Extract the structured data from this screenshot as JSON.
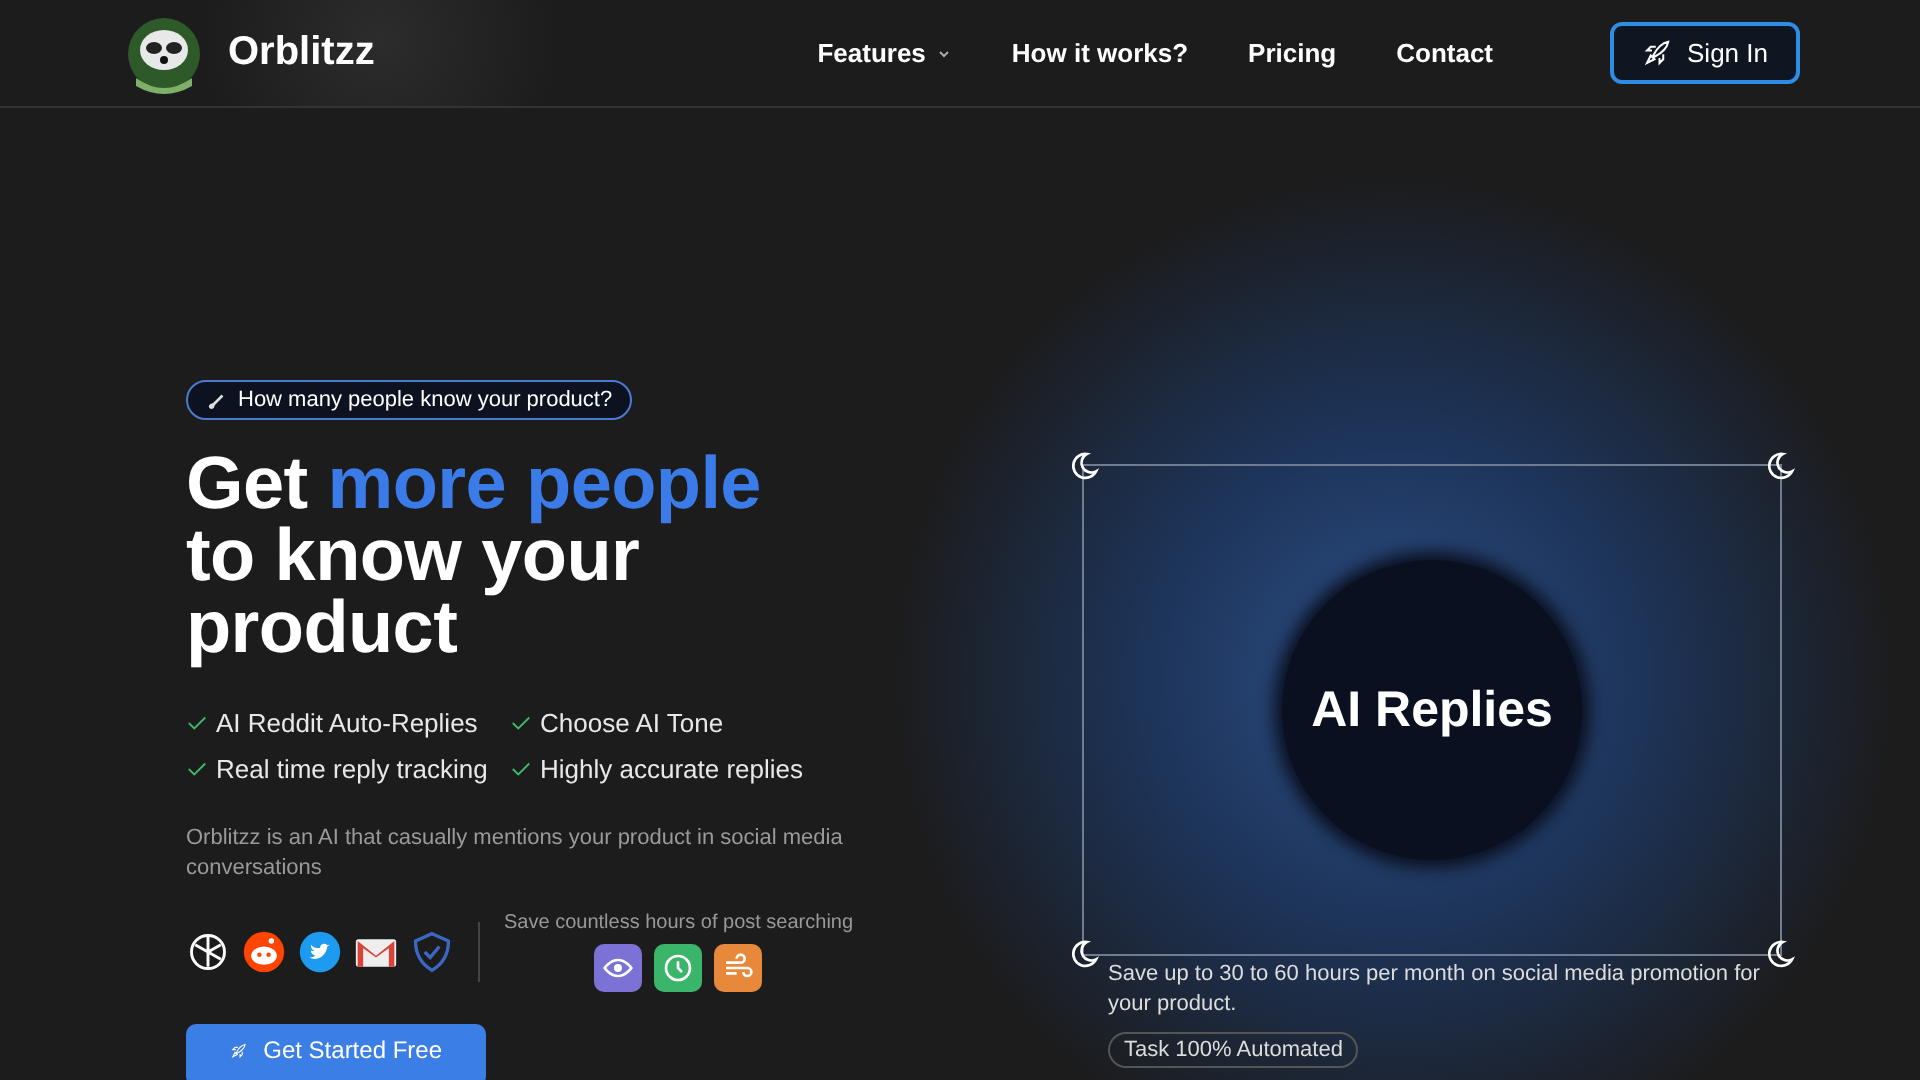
{
  "nav": {
    "brand": "Orblitzz",
    "links": [
      {
        "label": "Features",
        "dropdown": true
      },
      {
        "label": "How it works?",
        "dropdown": false
      },
      {
        "label": "Pricing",
        "dropdown": false
      },
      {
        "label": "Contact",
        "dropdown": false
      }
    ],
    "sign_in": "Sign In"
  },
  "hero": {
    "badge": "How many people know your product?",
    "heading": {
      "lead": "Get",
      "highlight": "more people",
      "rest": "to know your product"
    },
    "features": [
      "AI Reddit Auto-Replies",
      "Choose AI Tone",
      "Real time reply tracking",
      "Highly accurate replies"
    ],
    "description": "Orblitzz is an AI that casually mentions your product in social media conversations",
    "platforms": [
      {
        "kind": "openai"
      },
      {
        "kind": "reddit"
      },
      {
        "kind": "twitter"
      },
      {
        "kind": "mail"
      },
      {
        "kind": "shield"
      }
    ],
    "save_caption": "Save countless hours of post searching",
    "tools": [
      {
        "kind": "eye",
        "color": "#7b72d6"
      },
      {
        "kind": "clock",
        "color": "#3bb56a"
      },
      {
        "kind": "wind",
        "color": "#e8883a"
      }
    ],
    "cta": "Get Started Free"
  },
  "showcase": {
    "title": "AI Replies",
    "caption": "Save up to 30 to 60 hours per month on social media promotion for your product.",
    "tag": "Task 100% Automated"
  }
}
